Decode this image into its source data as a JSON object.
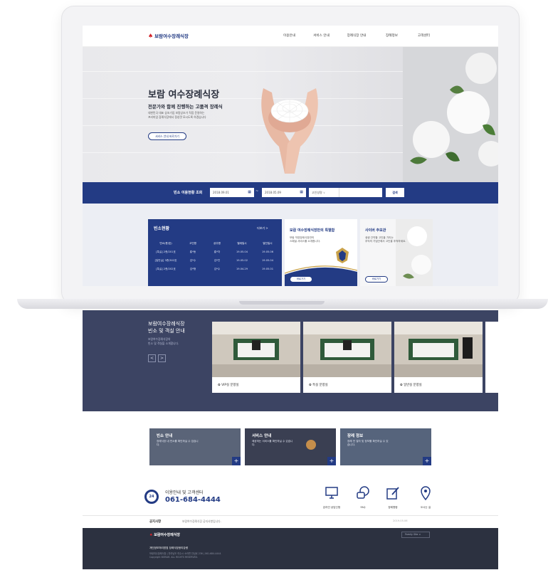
{
  "header": {
    "logo_text": "보람여수장례식장",
    "nav": [
      "이용안내",
      "서비스 안내",
      "장례식장 안내",
      "장례정보",
      "고객센터"
    ]
  },
  "hero": {
    "title": "보람 여수장례식장",
    "subtitle": "전문가와 함께 진행하는 고품격 장례식",
    "desc1": "대한민국 대표 상조기업 보람상조가 직접 운영하는",
    "desc2": "프리미엄 장례식장에서 정성껏 모시도록 하겠습니다",
    "button": "서비스 안내 바로가기"
  },
  "search": {
    "label": "빈소 이용현황 조회",
    "date_from": "2018.09.01",
    "date_to": "2018.05.09",
    "select": "고인성명",
    "button": "검색"
  },
  "status_board": {
    "title": "빈소현황",
    "more": "더보기 >",
    "columns": [
      "빈소(층/호)",
      "고인명",
      "상주명",
      "별세일시",
      "발인일시"
    ],
    "rows": [
      [
        "[특실] 2층/201호",
        "홍*동",
        "홍*자",
        "19.05.04",
        "19.05.06"
      ],
      [
        "[일반실] 3층/302호",
        "김*수",
        "김*진",
        "19.05.02",
        "19.05.04"
      ],
      [
        "[특실] 2층/202호",
        "김*형",
        "김*수",
        "19.04.29",
        "19.05.01"
      ]
    ]
  },
  "special_card": {
    "title": "보람 여수장례식장만의 특별함",
    "desc1": "보람 직영장례식장만의",
    "desc2": "스페셜 서비스를 소개합니다.",
    "button": "바로가기"
  },
  "memorial_card": {
    "title": "사이버 추모관",
    "desc1": "생생 간직할 고인을 기리는",
    "desc2": "추억의 기념관에서 고인을 추억하세요.",
    "button": "바로가기"
  },
  "rooms": {
    "title1": "보람여수장례식장",
    "title2": "빈소 및 객실 안내",
    "desc1": "보람여수장례식장의",
    "desc2": "빈소 및 객실을 소개합니다.",
    "prev": "<",
    "next": ">",
    "cards": [
      "VIP실 분향실",
      "특실 분향실",
      "일반실 분향실"
    ]
  },
  "quick_links": [
    {
      "title": "빈소 안내",
      "desc": "장례식장 내 빈소를 확인하실 수 있습니다."
    },
    {
      "title": "서비스 안내",
      "desc": "제공하는 서비스를 확인하실 수 있습니다."
    },
    {
      "title": "장례 정보",
      "desc": "장례 전 절차 및 정보를 확인하실 수 있습니다."
    }
  ],
  "contact": {
    "badge": "24",
    "label": "이용안내 및 고객센터",
    "phone": "061-684-4444",
    "services": [
      "온라인 상담신청",
      "FAQ",
      "장례명령",
      "오시는 길"
    ]
  },
  "notice": {
    "label": "공지사항",
    "text": "보람여수장례식장 공지사항입니다.",
    "date": "2019.05.06"
  },
  "footer": {
    "logo_text": "보람여수장례식장",
    "family": "Family Site",
    "links": "개인정보처리방침   장례식장윤리강령",
    "addr1": "보람여수장례식장 | 전라남도 여수시 소라면 안심로 236 | 061-684-4444",
    "copyright": "Copyright BORAM. ALL RIGHTS RESERVED."
  },
  "colors": {
    "brand": "#233b84",
    "accent": "#d2232a"
  }
}
